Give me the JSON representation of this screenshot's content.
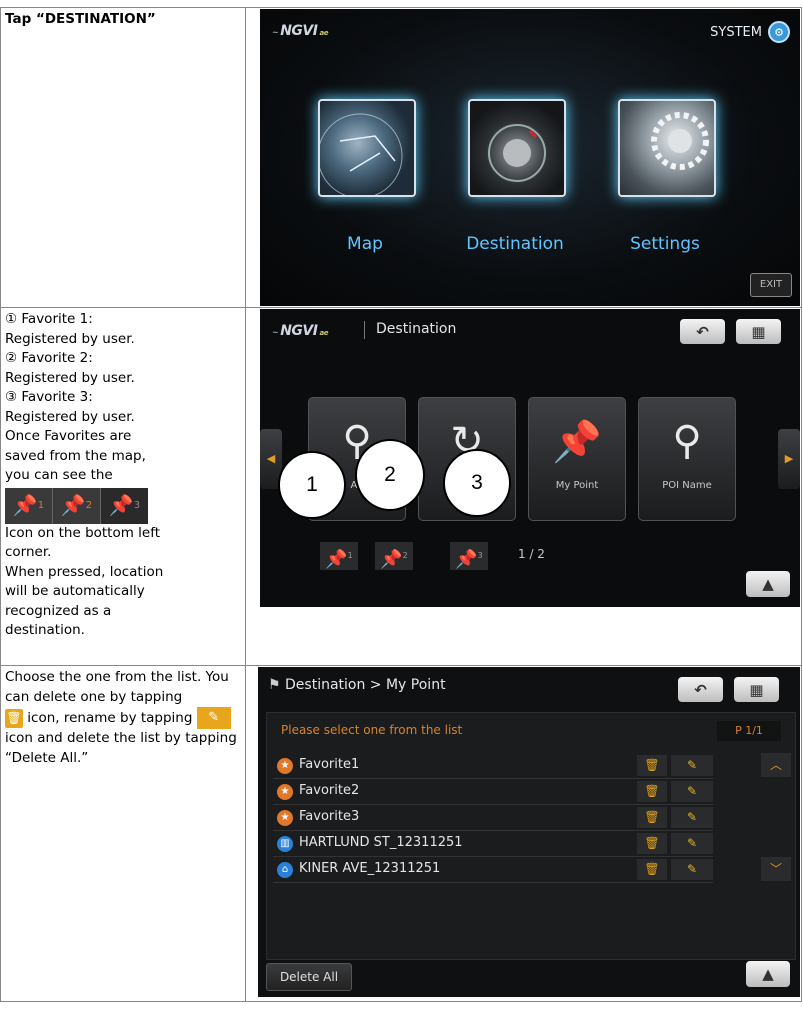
{
  "row1": {
    "instruction": "Tap “DESTINATION”",
    "screen": {
      "logo": "NGVI",
      "system_label": "SYSTEM",
      "tiles": [
        {
          "label": "Map",
          "icon": "globe-icon"
        },
        {
          "label": "Destination",
          "icon": "compass-icon"
        },
        {
          "label": "Settings",
          "icon": "gear-icon"
        }
      ],
      "exit_label": "EXIT"
    }
  },
  "row2": {
    "lines": [
      "① Favorite 1:",
      "Registered by user.",
      "② Favorite 2:",
      "Registered by user.",
      "③ Favorite 3:",
      "Registered by user.",
      "Once Favorites are",
      "saved from the map,",
      "you can see the"
    ],
    "pins": [
      "1",
      "2",
      "3"
    ],
    "lines_after": [
      "Icon on the bottom left",
      "corner.",
      "When pressed, location",
      "will be automatically",
      "recognized as a",
      "destination."
    ],
    "screen": {
      "logo": "NGVI",
      "title": "Destination",
      "cards": [
        {
          "label": "Ad",
          "icon": "address-search-icon"
        },
        {
          "label": "",
          "icon": "recent-icon"
        },
        {
          "label": "My Point",
          "icon": "pin-icon"
        },
        {
          "label": "POI Name",
          "icon": "poi-search-icon"
        }
      ],
      "favorites": [
        "1",
        "2",
        "3"
      ],
      "page": "1 / 2",
      "callouts": [
        "1",
        "2",
        "3"
      ]
    }
  },
  "row3": {
    "text": {
      "p1": "Choose the one from the list.  You can delete one by tapping",
      "p2": " icon, rename by tapping ",
      "p3": " icon and delete the list by tapping “Delete All.”"
    },
    "screen": {
      "breadcrumb": "Destination > My Point",
      "prompt": "Please select one from the list",
      "page": "P 1/1",
      "items": [
        {
          "name": "Favorite1",
          "icon": "favorite-icon",
          "color": "#e0782a"
        },
        {
          "name": "Favorite2",
          "icon": "favorite-icon",
          "color": "#e0782a"
        },
        {
          "name": "Favorite3",
          "icon": "favorite-icon",
          "color": "#e0782a"
        },
        {
          "name": "HARTLUND ST_12311251",
          "icon": "building-icon",
          "color": "#2a82d8"
        },
        {
          "name": "KINER AVE_12311251",
          "icon": "home-icon",
          "color": "#2a82d8"
        }
      ],
      "delete_all_label": "Delete All"
    }
  }
}
